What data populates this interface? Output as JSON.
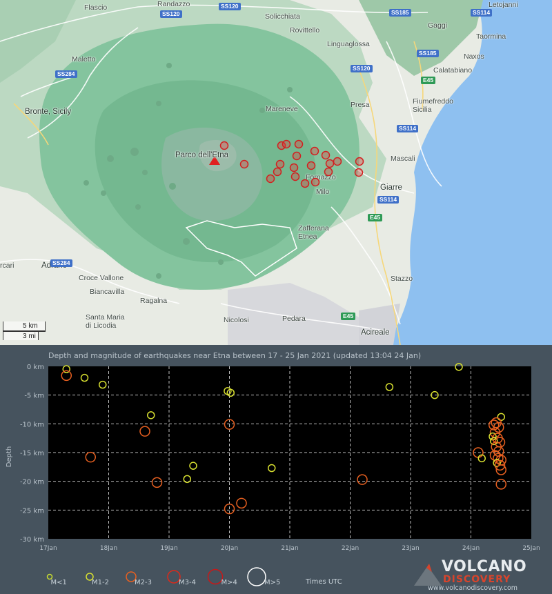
{
  "map": {
    "places": [
      {
        "name": "Randazzo",
        "big": false
      },
      {
        "name": "Flascio",
        "big": false
      },
      {
        "name": "Solicchiata",
        "big": false
      },
      {
        "name": "Rovittello",
        "big": false
      },
      {
        "name": "Linguaglossa",
        "big": false
      },
      {
        "name": "Gaggi",
        "big": false
      },
      {
        "name": "Letojanni",
        "big": false
      },
      {
        "name": "Taormina",
        "big": false
      },
      {
        "name": "Naxos",
        "big": false
      },
      {
        "name": "Calatabiano",
        "big": false
      },
      {
        "name": "Maletto",
        "big": false
      },
      {
        "name": "Bronte, Sicily",
        "big": true
      },
      {
        "name": "Mareneve",
        "big": false
      },
      {
        "name": "Presa",
        "big": false
      },
      {
        "name": "Fiumefreddo\nSicilia",
        "big": false
      },
      {
        "name": "Parco dell'Etna",
        "big": true
      },
      {
        "name": "Mascali",
        "big": false
      },
      {
        "name": "Fornazzo",
        "big": false
      },
      {
        "name": "Milo",
        "big": false
      },
      {
        "name": "Giarre",
        "big": true
      },
      {
        "name": "Zafferana\nEtnea",
        "big": false
      },
      {
        "name": "Adrano",
        "big": true
      },
      {
        "name": "Croce Vallone",
        "big": false
      },
      {
        "name": "Biancavilla",
        "big": false
      },
      {
        "name": "Ragalna",
        "big": false
      },
      {
        "name": "Stazzo",
        "big": false
      },
      {
        "name": "Santa Maria\ndi Licodia",
        "big": false
      },
      {
        "name": "Nicolosi",
        "big": false
      },
      {
        "name": "Pedara",
        "big": false
      },
      {
        "name": "Acireale",
        "big": true
      },
      {
        "name": "rcari",
        "big": false
      }
    ],
    "roads": [
      {
        "label": "SS120",
        "green": false
      },
      {
        "label": "SS120",
        "green": false
      },
      {
        "label": "SS185",
        "green": false
      },
      {
        "label": "SS114",
        "green": false
      },
      {
        "label": "SS185",
        "green": false
      },
      {
        "label": "SS120",
        "green": false
      },
      {
        "label": "E45",
        "green": true
      },
      {
        "label": "SS284",
        "green": false
      },
      {
        "label": "SS114",
        "green": false
      },
      {
        "label": "SS114",
        "green": false
      },
      {
        "label": "E45",
        "green": true
      },
      {
        "label": "SS284",
        "green": false
      },
      {
        "label": "E45",
        "green": true
      }
    ],
    "scale_km": "5 km",
    "scale_mi": "3 mi",
    "volcano_icon": "red-triangle-volcano-icon",
    "quake_marker_color": "#e03030"
  },
  "chart_data": {
    "type": "scatter",
    "title": "Depth and magnitude of earthquakes near Etna between 17 - 25 Jan 2021 (updated 13:04 24 Jan)",
    "ylabel": "Depth",
    "xlabel": "",
    "x_ticks": [
      "17Jan",
      "18Jan",
      "19Jan",
      "20Jan",
      "21Jan",
      "22Jan",
      "23Jan",
      "24Jan",
      "25Jan"
    ],
    "y_ticks": [
      "0 km",
      "-5 km",
      "-10 km",
      "-15 km",
      "-20 km",
      "-25 km",
      "-30 km"
    ],
    "xlim_days": [
      17,
      25
    ],
    "ylim_km": [
      -30,
      0
    ],
    "grid": true,
    "background": "#000000",
    "magnitude_classes": [
      {
        "label": "M<1",
        "color": "#c8dc30"
      },
      {
        "label": "M1-2",
        "color": "#d8e030"
      },
      {
        "label": "M2-3",
        "color": "#e86020"
      },
      {
        "label": "M3-4",
        "color": "#e02818"
      },
      {
        "label": "M>4",
        "color": "#c81818"
      },
      {
        "label": "M>5",
        "color": "#ffffff"
      }
    ],
    "points": [
      {
        "day": 17.3,
        "depth": -0.5,
        "mag": "M1-2"
      },
      {
        "day": 17.3,
        "depth": -1.6,
        "mag": "M2-3"
      },
      {
        "day": 17.6,
        "depth": -2.0,
        "mag": "M1-2"
      },
      {
        "day": 17.9,
        "depth": -3.2,
        "mag": "M1-2"
      },
      {
        "day": 17.7,
        "depth": -15.8,
        "mag": "M2-3"
      },
      {
        "day": 18.7,
        "depth": -8.5,
        "mag": "M1-2"
      },
      {
        "day": 18.6,
        "depth": -11.3,
        "mag": "M2-3"
      },
      {
        "day": 18.8,
        "depth": -20.2,
        "mag": "M2-3"
      },
      {
        "day": 19.4,
        "depth": -17.3,
        "mag": "M1-2"
      },
      {
        "day": 19.3,
        "depth": -19.6,
        "mag": "M1-2"
      },
      {
        "day": 19.97,
        "depth": -4.3,
        "mag": "M1-2"
      },
      {
        "day": 20.02,
        "depth": -4.6,
        "mag": "M1-2"
      },
      {
        "day": 20.0,
        "depth": -10.1,
        "mag": "M2-3"
      },
      {
        "day": 20.0,
        "depth": -24.8,
        "mag": "M2-3"
      },
      {
        "day": 20.2,
        "depth": -23.8,
        "mag": "M2-3"
      },
      {
        "day": 20.7,
        "depth": -17.7,
        "mag": "M1-2"
      },
      {
        "day": 22.2,
        "depth": -19.7,
        "mag": "M2-3"
      },
      {
        "day": 22.65,
        "depth": -3.6,
        "mag": "M1-2"
      },
      {
        "day": 23.8,
        "depth": -0.1,
        "mag": "M1-2"
      },
      {
        "day": 23.4,
        "depth": -5.0,
        "mag": "M1-2"
      },
      {
        "day": 24.12,
        "depth": -15.0,
        "mag": "M2-3"
      },
      {
        "day": 24.18,
        "depth": -16.0,
        "mag": "M1-2"
      },
      {
        "day": 24.5,
        "depth": -8.8,
        "mag": "M1-2"
      },
      {
        "day": 24.38,
        "depth": -10.2,
        "mag": "M2-3"
      },
      {
        "day": 24.42,
        "depth": -9.8,
        "mag": "M2-3"
      },
      {
        "day": 24.46,
        "depth": -10.6,
        "mag": "M2-3"
      },
      {
        "day": 24.4,
        "depth": -11.5,
        "mag": "M2-3"
      },
      {
        "day": 24.36,
        "depth": -12.2,
        "mag": "M1-2"
      },
      {
        "day": 24.44,
        "depth": -12.5,
        "mag": "M2-3"
      },
      {
        "day": 24.38,
        "depth": -13.0,
        "mag": "M1-2"
      },
      {
        "day": 24.48,
        "depth": -13.2,
        "mag": "M2-3"
      },
      {
        "day": 24.42,
        "depth": -14.0,
        "mag": "M2-3"
      },
      {
        "day": 24.46,
        "depth": -14.8,
        "mag": "M2-3"
      },
      {
        "day": 24.4,
        "depth": -15.5,
        "mag": "M2-3"
      },
      {
        "day": 24.45,
        "depth": -16.0,
        "mag": "M2-3"
      },
      {
        "day": 24.5,
        "depth": -16.3,
        "mag": "M2-3"
      },
      {
        "day": 24.43,
        "depth": -16.8,
        "mag": "M1-2"
      },
      {
        "day": 24.48,
        "depth": -17.2,
        "mag": "M2-3"
      },
      {
        "day": 24.5,
        "depth": -18.0,
        "mag": "M2-3"
      },
      {
        "day": 24.5,
        "depth": -20.5,
        "mag": "M2-3"
      }
    ]
  },
  "legend": {
    "items": [
      "M<1",
      "M1-2",
      "M2-3",
      "M3-4",
      "M>4",
      "M>5"
    ],
    "times": "Times UTC"
  },
  "logo": {
    "line1": "VOLCANO",
    "line2": "DISCOVERY",
    "url": "www.volcanodiscovery.com"
  }
}
